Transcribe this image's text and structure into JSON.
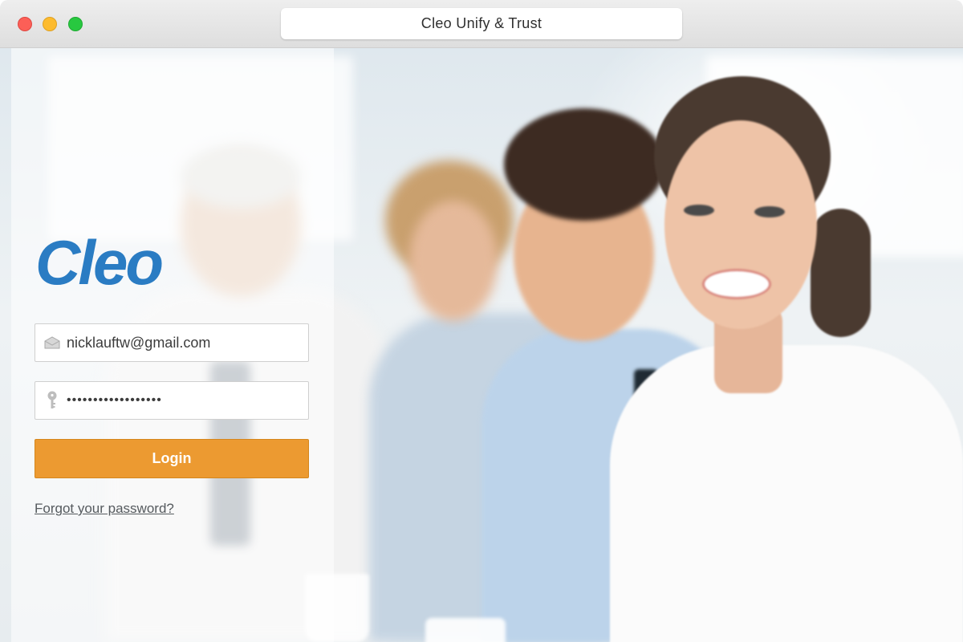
{
  "window": {
    "title": "Cleo Unify & Trust"
  },
  "branding": {
    "logo_text": "Cleo",
    "logo_color": "#2a7cc3"
  },
  "login": {
    "email_value": "nicklauftw@gmail.com",
    "password_value": "••••••••••••••••••",
    "login_label": "Login",
    "forgot_label": "Forgot your password?",
    "button_color": "#ec9a31"
  },
  "icons": {
    "email": "envelope-icon",
    "password": "key-icon"
  }
}
